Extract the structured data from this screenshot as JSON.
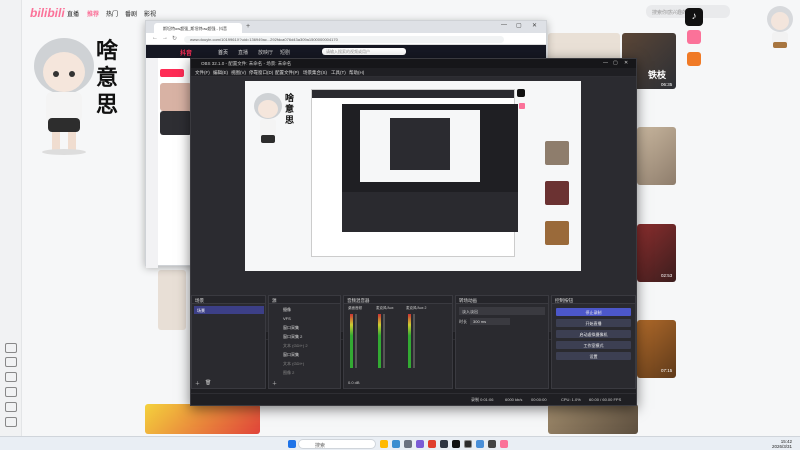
{
  "bilibili": {
    "logo": "bilibili",
    "nav": [
      "直播",
      "推荐",
      "热门",
      "番剧",
      "影视"
    ],
    "search_placeholder": "搜索你感兴趣的视频",
    "sticker_caption": "啥意思",
    "thumb_times": [
      "06:35",
      "02:53",
      "07:15"
    ],
    "thumb_text": [
      "铁枝"
    ]
  },
  "browser": {
    "tab_title": "斯坦特ow超强_斯坦特ow超强 - 抖音",
    "url": "www.douyin.com/1019961X?uid=136949ac...292fdca076d43a309a1500000004170",
    "site_logo": "抖音",
    "site_nav": [
      "首页",
      "直播",
      "放映厅",
      "短剧"
    ],
    "search_placeholder": "请输入搜索的视频或用户"
  },
  "obs": {
    "title": "OBS 32.1.0 - 配置文件: 未命名 - 场景: 未命名",
    "menu": [
      "文件(F)",
      "编辑(E)",
      "视图(V)",
      "停靠窗口(D)",
      "配置文件(P)",
      "场景集合(S)",
      "工具(T)",
      "帮助(H)"
    ],
    "toolbar": [
      "未选择源",
      "设置",
      "滤镜"
    ],
    "docks": {
      "scenes": {
        "title": "场景",
        "items": [
          "场景"
        ]
      },
      "sources": {
        "title": "源",
        "items": [
          "摄像",
          "VFS",
          "窗口采集",
          "窗口采集 2",
          "文本 (GDI+) 2",
          "窗口采集",
          "文本 (GDI+)",
          "图像 2"
        ]
      },
      "mixer": {
        "title": "音频混音器",
        "channels": [
          "桌面音频",
          "麦克风/Aux",
          "麦克风/Aux 2"
        ],
        "db": [
          "-0.0 dB",
          "0.0 dB",
          "0.0 dB"
        ],
        "footer": "0.0 dB"
      },
      "transitions": {
        "title": "转场动画",
        "type": "淡入淡出",
        "duration_label": "时长",
        "duration": "300 ms"
      },
      "controls": {
        "title": "控制按钮",
        "buttons": [
          "停止录制",
          "开始直播",
          "启动虚拟摄像机",
          "工作室模式",
          "设置"
        ]
      }
    },
    "status": {
      "recording": "录制 0:01:06",
      "bitrate": "6000 kb/s",
      "time": "00:00:00",
      "cpu": "CPU: 1.0%",
      "fps": "60.00 / 60.00 FPS"
    }
  },
  "taskbar": {
    "search": "搜索",
    "time": "15:42",
    "date": "2026/3/31"
  }
}
